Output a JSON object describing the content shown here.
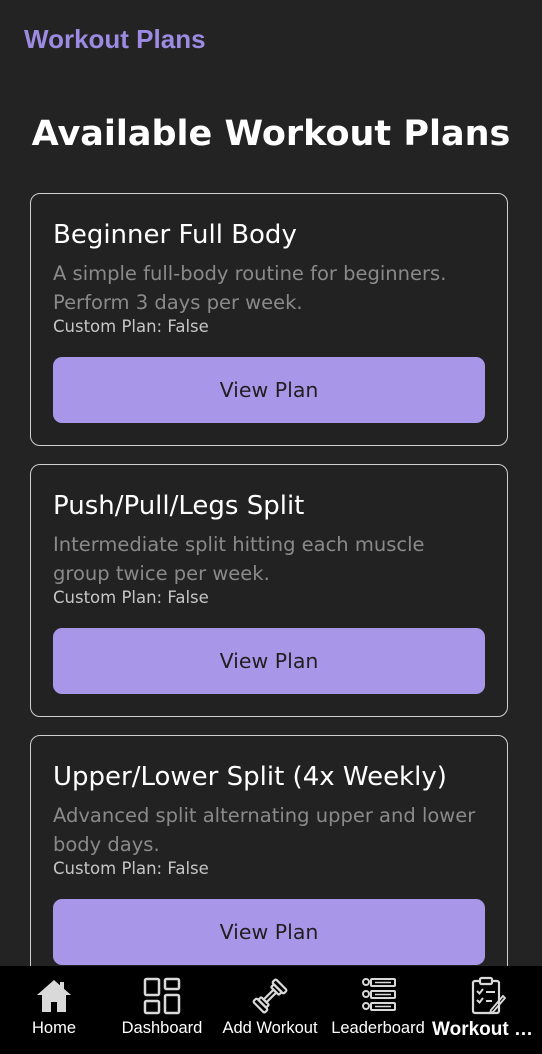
{
  "app": {
    "header_title": "Workout Plans"
  },
  "main": {
    "title": "Available Workout Plans",
    "plans": [
      {
        "title": "Beginner Full Body",
        "description": "A simple full-body routine for beginners. Perform 3 days per week.",
        "custom": "Custom Plan: False",
        "button": "View Plan"
      },
      {
        "title": "Push/Pull/Legs Split",
        "description": "Intermediate split hitting each muscle group twice per week.",
        "custom": "Custom Plan: False",
        "button": "View Plan"
      },
      {
        "title": "Upper/Lower Split (4x Weekly)",
        "description": "Advanced split alternating upper and lower body days.",
        "custom": "Custom Plan: False",
        "button": "View Plan"
      }
    ]
  },
  "nav": {
    "items": [
      {
        "label": "Home",
        "icon": "home-icon"
      },
      {
        "label": "Dashboard",
        "icon": "dashboard-icon"
      },
      {
        "label": "Add Workout",
        "icon": "dumbbell-icon"
      },
      {
        "label": "Leaderboard",
        "icon": "leaderboard-icon"
      },
      {
        "label": "Workout Plans",
        "icon": "clipboard-icon",
        "active": true
      }
    ]
  },
  "colors": {
    "background": "#232323",
    "accent": "#9d8be3",
    "button": "#a897e8",
    "nav_background": "#000000"
  }
}
